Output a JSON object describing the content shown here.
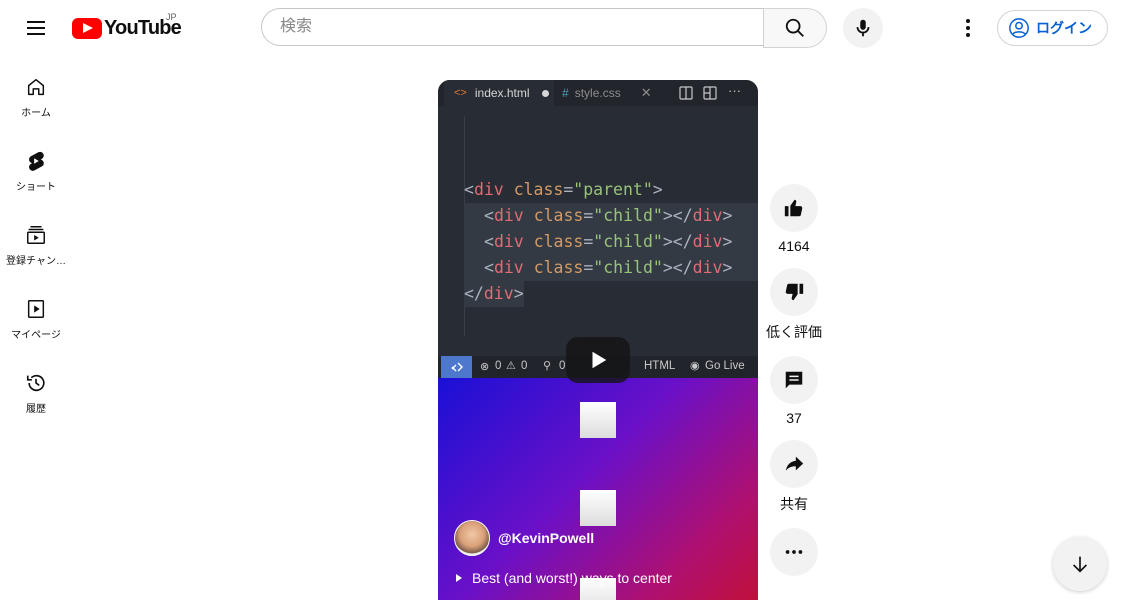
{
  "header": {
    "logo_text": "YouTube",
    "region": "JP",
    "search_placeholder": "検索",
    "login_label": "ログイン"
  },
  "guide": {
    "items": [
      {
        "label": "ホーム",
        "icon": "home-icon"
      },
      {
        "label": "ショート",
        "icon": "shorts-icon"
      },
      {
        "label": "登録チャン…",
        "icon": "subscriptions-icon"
      },
      {
        "label": "マイページ",
        "icon": "you-icon"
      },
      {
        "label": "履歴",
        "icon": "history-icon"
      }
    ]
  },
  "video": {
    "editor": {
      "tabs": [
        {
          "name": "index.html",
          "icon": "<>"
        },
        {
          "name": "style.css",
          "icon": "#"
        }
      ],
      "code_lines": [
        {
          "open": "<",
          "tag": "div",
          "attr": "class",
          "eq": "=",
          "val": "\"parent\"",
          "close": ">"
        },
        {
          "open": "<",
          "tag": "div",
          "attr": "class",
          "eq": "=",
          "val": "\"child\"",
          "close": "></",
          "tag2": "div",
          "end": ">"
        },
        {
          "open": "<",
          "tag": "div",
          "attr": "class",
          "eq": "=",
          "val": "\"child\"",
          "close": "></",
          "tag2": "div",
          "end": ">"
        },
        {
          "open": "<",
          "tag": "div",
          "attr": "class",
          "eq": "=",
          "val": "\"child\"",
          "close": "></",
          "tag2": "div",
          "end": ">"
        },
        {
          "open": "</",
          "tag": "div",
          "close": ">"
        }
      ],
      "status": {
        "errors": "0",
        "warnings": "0",
        "ports": "0",
        "language": "HTML",
        "live": "Go Live"
      }
    },
    "channel": "@KevinPowell",
    "title": "Best (and worst!) ways to center"
  },
  "actions": {
    "like_count": "4164",
    "dislike_label": "低く評価",
    "comment_count": "37",
    "share_label": "共有"
  },
  "colors": {
    "brand_red": "#ff0000",
    "link_blue": "#065fd4"
  }
}
